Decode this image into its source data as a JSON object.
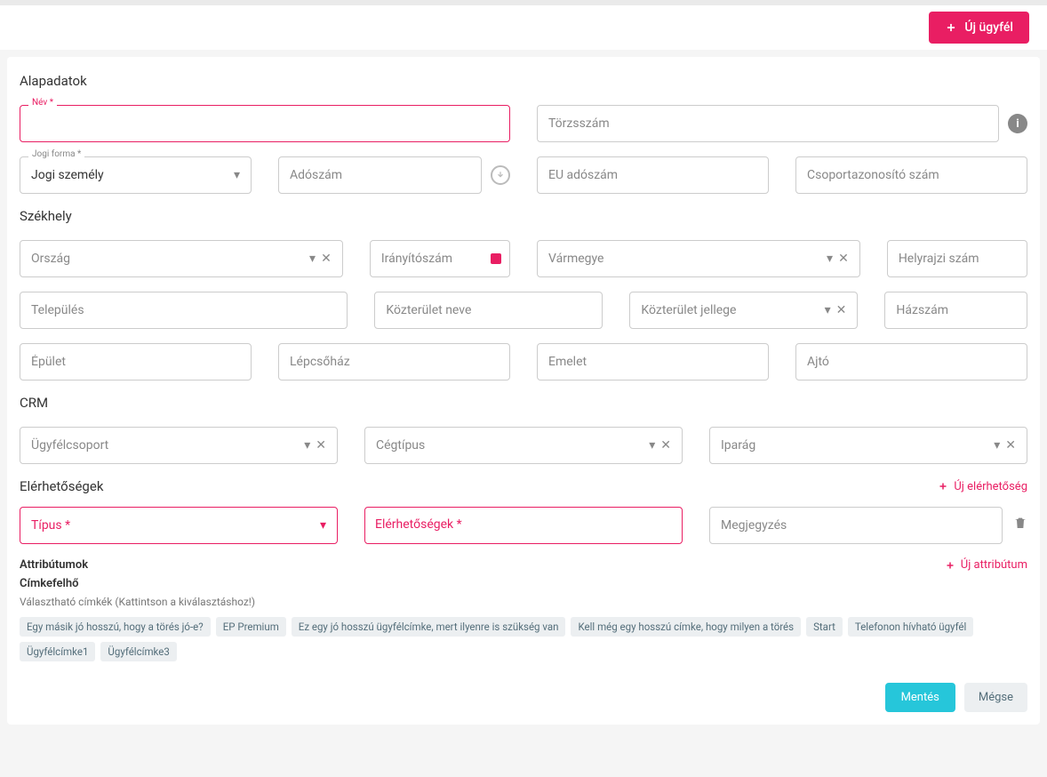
{
  "header": {
    "new_client": "Új ügyfél"
  },
  "sections": {
    "basic": "Alapadatok",
    "hq": "Székhely",
    "crm": "CRM",
    "contacts": "Elérhetőségek",
    "attributes": "Attribútumok"
  },
  "basic": {
    "name_label": "Név *",
    "reg_number": "Törzsszám",
    "legal_form_label": "Jogi forma *",
    "legal_form_value": "Jogi személy",
    "tax_number": "Adószám",
    "eu_tax": "EU adószám",
    "group_id": "Csoportazonosító szám"
  },
  "hq": {
    "country": "Ország",
    "zip": "Irányítószám",
    "county": "Vármegye",
    "topographic": "Helyrajzi szám",
    "settlement": "Település",
    "street_name": "Közterület neve",
    "street_type": "Közterület jellege",
    "house": "Házszám",
    "building": "Épület",
    "staircase": "Lépcsőház",
    "floor": "Emelet",
    "door": "Ajtó"
  },
  "crm": {
    "group": "Ügyfélcsoport",
    "company_type": "Cégtípus",
    "industry": "Iparág"
  },
  "contacts": {
    "add": "Új elérhetőség",
    "type": "Típus *",
    "contacts_label": "Elérhetőségek *",
    "note": "Megjegyzés"
  },
  "attributes": {
    "add": "Új attribútum",
    "cloud_title": "Címkefelhő",
    "cloud_hint": "Választható címkék (Kattintson a kiválasztáshoz!)",
    "tags": [
      "Egy másik jó hosszú, hogy a törés jó-e?",
      "EP Premium",
      "Ez egy jó hosszú ügyfélcímke, mert ilyenre is szükség van",
      "Kell még egy hosszú címke, hogy milyen a törés",
      "Start",
      "Telefonon hívható ügyfél",
      "Ügyfélcímke1",
      "Ügyfélcímke3"
    ]
  },
  "footer": {
    "save": "Mentés",
    "cancel": "Mégse"
  }
}
